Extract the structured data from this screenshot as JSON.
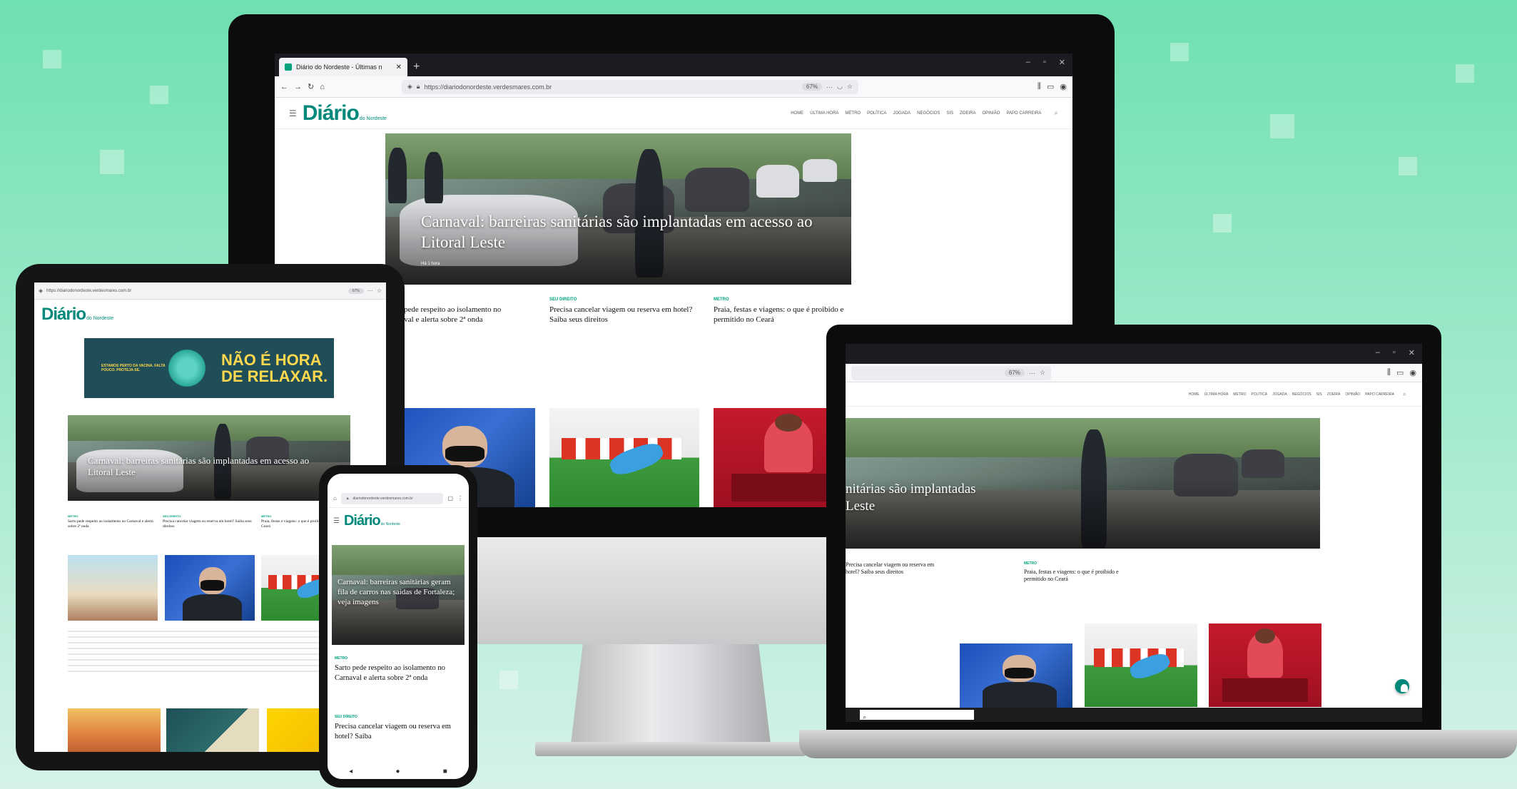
{
  "colors": {
    "brand": "#00897b",
    "accent": "#00a37e",
    "browser_dark": "#1c1b22"
  },
  "site": {
    "logo": "Diário",
    "logo_sub": "do Nordeste",
    "menu": [
      "HOME",
      "ÚLTIMA HORA",
      "METRO",
      "POLÍTICA",
      "JOGADA",
      "NEGÓCIOS",
      "SIS",
      "ZOEIRA",
      "OPINIÃO",
      "PAPO CARREIRA"
    ]
  },
  "browser": {
    "tab_title": "Diário do Nordeste - Últimas n",
    "url": "https://diariodonordeste.verdesmares.com.br",
    "zoom": "67%",
    "new_tab": "+"
  },
  "hero": {
    "title": "Carnaval: barreiras sanitárias são implantadas em acesso ao Litoral Leste",
    "tag": "Há 1 hora"
  },
  "stories": [
    {
      "kicker": "METRO",
      "headline": "Sarto pede respeito ao isolamento no Carnaval e alerta sobre 2ª onda"
    },
    {
      "kicker": "SEU DIREITO",
      "headline": "Precisa cancelar viagem ou reserva em hotel? Saiba seus direitos"
    },
    {
      "kicker": "METRO",
      "headline": "Praia, festas e viagens: o que é proibido e permitido no Ceará"
    }
  ],
  "laptop": {
    "hero_title": "nitárias são implantadas",
    "hero_title_2": "Leste",
    "story_a": "Precisa cancelar viagem ou reserva em hotel? Saiba seus direitos",
    "story_b": "Praia, festas e viagens: o que é proibido e permitido no Ceará"
  },
  "tablet": {
    "url": "https://diariodonordeste.verdesmares.com.br",
    "ad_small": "ESTAMOS PERTO DA VACINA. FALTA POUCO. PROTEJA-SE.",
    "ad_big_1": "NÃO É HORA",
    "ad_big_2": "DE RELAXAR."
  },
  "phone": {
    "url": "diariodonordeste.verdesmares.com.br",
    "hero_title": "Carnaval: barreiras sanitárias geram fila de carros nas saídas de Fortaleza; veja imagens",
    "story1_kicker": "METRO",
    "story1": "Sarto pede respeito ao isolamento no Carnaval e alerta sobre 2ª onda",
    "story2_kicker": "SEU DIREITO",
    "story2": "Precisa cancelar viagem ou reserva em hotel? Saiba"
  }
}
